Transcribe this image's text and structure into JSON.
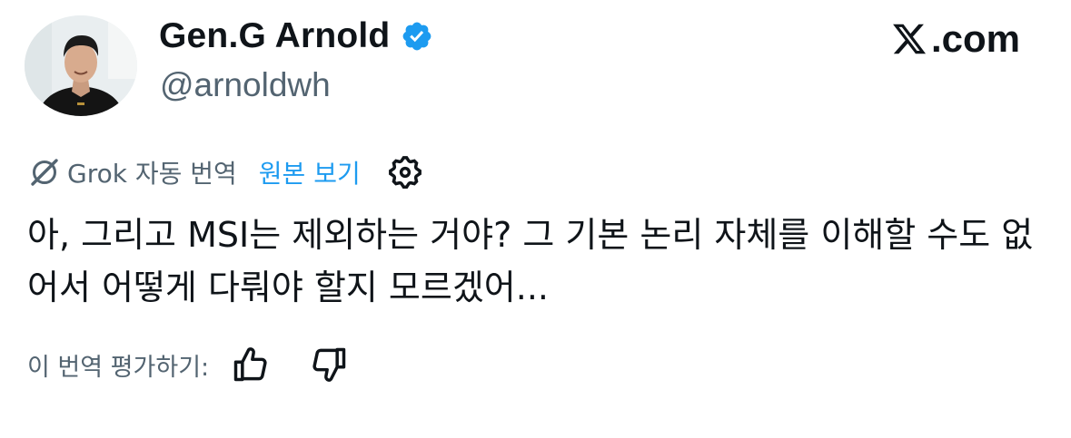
{
  "author": {
    "display_name": "Gen.G Arnold",
    "handle": "@arnoldwh",
    "verified": true,
    "verified_color": "#1d9bf0"
  },
  "brand": {
    "logo_icon": "x-logo-icon",
    "domain": ".com"
  },
  "translation": {
    "icon": "grok-icon",
    "label": "Grok 자동 번역",
    "show_original": "원본 보기",
    "settings_icon": "settings-gear-icon",
    "link_color": "#1d9bf0"
  },
  "tweet": {
    "text": "아, 그리고 MSI는 제외하는 거야? 그 기본 논리 자체를 이해할 수도 없어서 어떻게 다뤄야 할지 모르겠어..."
  },
  "rating": {
    "label": "이 번역 평가하기:",
    "up_icon": "thumbs-up-icon",
    "down_icon": "thumbs-down-icon"
  },
  "colors": {
    "text_primary": "#0f1419",
    "text_secondary": "#536471",
    "accent": "#1d9bf0",
    "background": "#ffffff"
  }
}
